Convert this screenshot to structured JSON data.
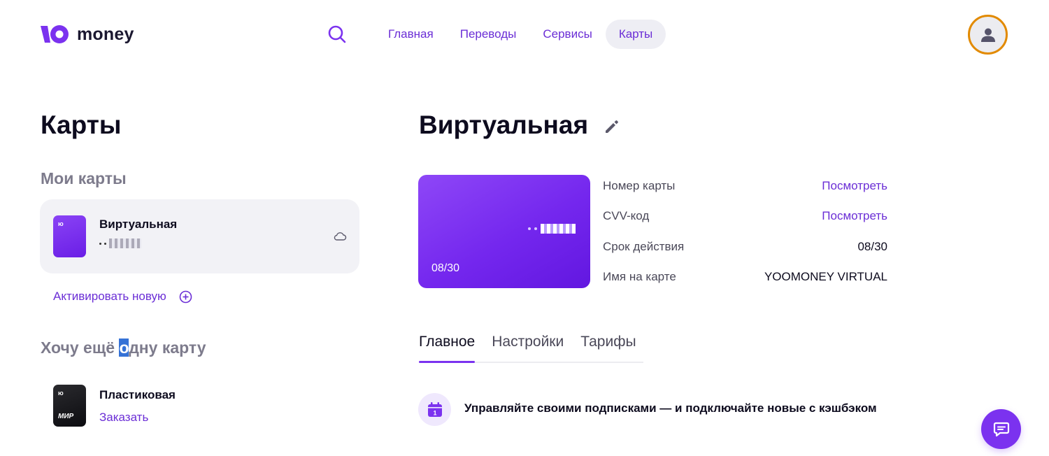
{
  "header": {
    "logo_text": "money",
    "nav": [
      {
        "label": "Главная"
      },
      {
        "label": "Переводы"
      },
      {
        "label": "Сервисы"
      },
      {
        "label": "Карты",
        "active": true
      }
    ],
    "icons": {
      "search": "search-icon",
      "avatar": "user-icon"
    },
    "colors": {
      "accent": "#6b2ed6",
      "avatar_ring": "#e28a00"
    }
  },
  "left": {
    "page_title": "Карты",
    "my_cards_title": "Мои карты",
    "card": {
      "name": "Виртуальная",
      "mini_label": "ю",
      "icon": "cloud-icon"
    },
    "activate_label": "Активировать новую",
    "want_title_prefix": "Хочу ещё ",
    "want_title_highlight": "о",
    "want_title_suffix": "дну карту",
    "plastic": {
      "name": "Пластиковая",
      "action": "Заказать",
      "mini_label": "ю",
      "brand": "МИР"
    }
  },
  "detail": {
    "title": "Виртуальная",
    "card_expiry": "08/30",
    "info": [
      {
        "label": "Номер карты",
        "value": "Посмотреть",
        "link": true
      },
      {
        "label": "CVV-код",
        "value": "Посмотреть",
        "link": true
      },
      {
        "label": "Срок действия",
        "value": "08/30",
        "link": false
      },
      {
        "label": "Имя на карте",
        "value": "YOOMONEY VIRTUAL",
        "link": false
      }
    ],
    "tabs": [
      {
        "label": "Главное",
        "active": true
      },
      {
        "label": "Настройки"
      },
      {
        "label": "Тарифы"
      }
    ],
    "promo_text": "Управляйте своими подписками — и подключайте новые с кэшбэком",
    "promo_icon": "calendar-icon",
    "promo_icon_day": "1"
  },
  "chat": {
    "icon": "chat-icon"
  }
}
